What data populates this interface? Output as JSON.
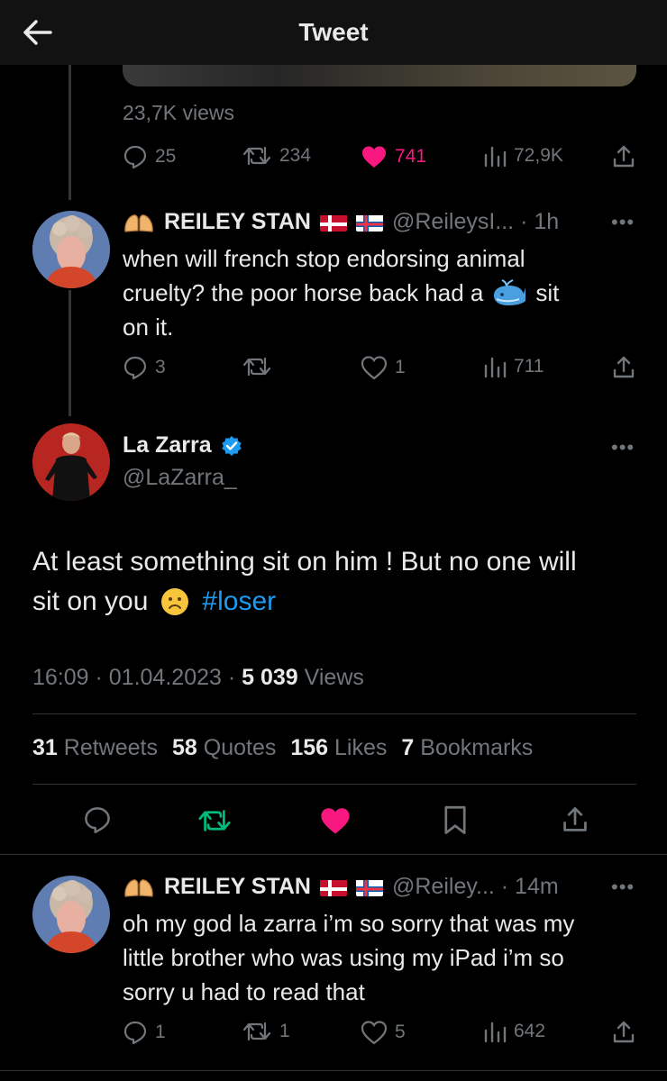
{
  "header": {
    "title": "Tweet"
  },
  "parent_stats": {
    "views_text": "23,7K views",
    "replies": "25",
    "retweets": "234",
    "likes": "741",
    "views": "72,9K"
  },
  "reply1": {
    "display_name": "REILEY STAN",
    "handle_time": "@ReileysI... · 1h",
    "text_a": "when will french stop endorsing animal",
    "text_b": "cruelty? the poor horse back had a",
    "text_c": "sit",
    "text_d": "on it.",
    "replies": "3",
    "likes": "1",
    "views": "711"
  },
  "main": {
    "display_name": "La Zarra",
    "handle": "@LaZarra_",
    "text_line1": "At least  something sit on him !  But no one will",
    "text_line2_a": "sit on you",
    "hashtag": "#loser",
    "timestamp": "16:09 · 01.04.2023 · ",
    "view_count": "5 039",
    "views_label": " Views",
    "retweets_count": "31",
    "retweets_label": "Retweets",
    "quotes_count": "58",
    "quotes_label": "Quotes",
    "likes_count": "156",
    "likes_label": "Likes",
    "bookmarks_count": "7",
    "bookmarks_label": "Bookmarks"
  },
  "reply2": {
    "display_name": "REILEY STAN",
    "handle_time": "@Reiley... · 14m",
    "text_line1": "oh my god la zarra i’m so sorry that was my",
    "text_line2": "little brother who was using my iPad i’m so",
    "text_line3": "sorry u had to read that",
    "replies": "1",
    "retweets": "1",
    "likes": "5",
    "views": "642"
  },
  "colors": {
    "like_pink": "#f91880",
    "retweet_green": "#00ba7c",
    "verified_blue": "#1d9bf0",
    "muted_gray": "#71767b"
  }
}
